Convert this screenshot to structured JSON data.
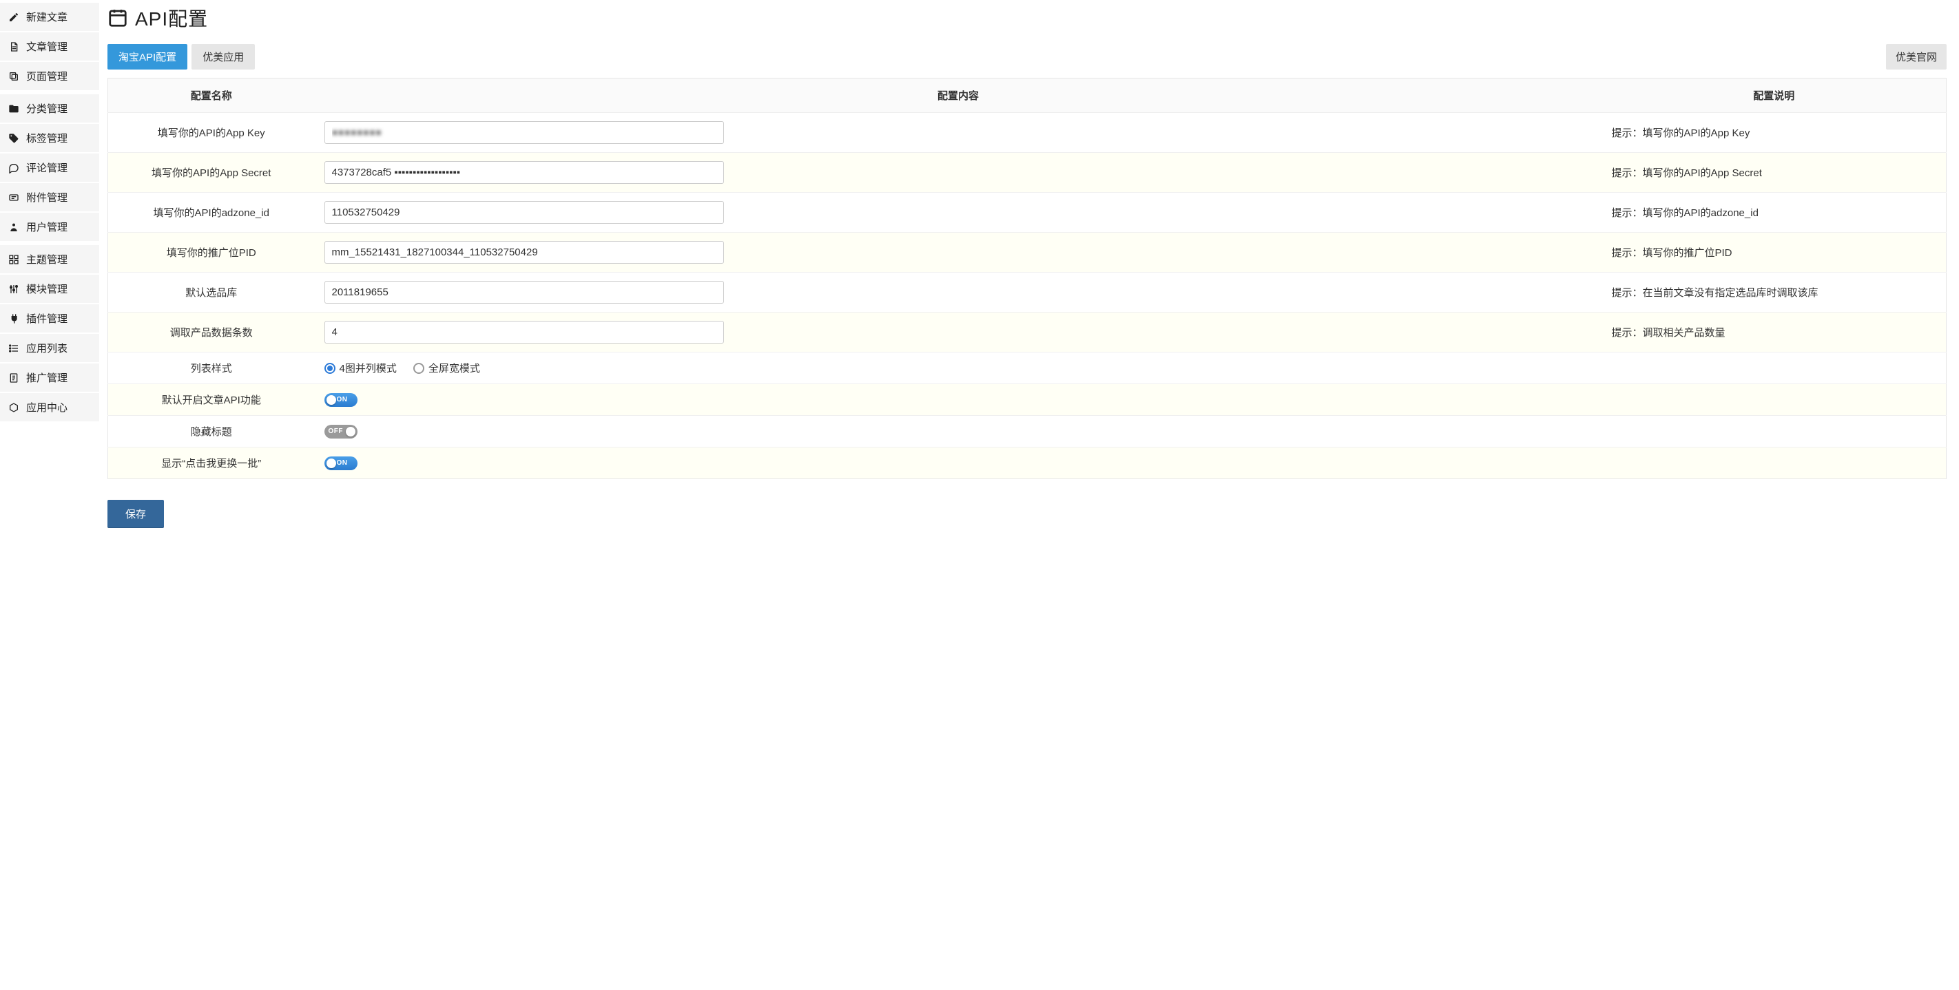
{
  "sidebar": {
    "groups": [
      [
        {
          "icon": "pencil",
          "label": "新建文章"
        },
        {
          "icon": "doc",
          "label": "文章管理"
        },
        {
          "icon": "copy",
          "label": "页面管理"
        }
      ],
      [
        {
          "icon": "folder",
          "label": "分类管理"
        },
        {
          "icon": "tag",
          "label": "标签管理"
        },
        {
          "icon": "comment",
          "label": "评论管理"
        },
        {
          "icon": "attach",
          "label": "附件管理"
        },
        {
          "icon": "user",
          "label": "用户管理"
        }
      ],
      [
        {
          "icon": "grid",
          "label": "主题管理"
        },
        {
          "icon": "module",
          "label": "模块管理"
        },
        {
          "icon": "plug",
          "label": "插件管理"
        },
        {
          "icon": "list",
          "label": "应用列表"
        },
        {
          "icon": "promo",
          "label": "推广管理"
        },
        {
          "icon": "cube",
          "label": "应用中心"
        }
      ]
    ]
  },
  "header": {
    "title": "API配置"
  },
  "tabs": {
    "items": [
      "淘宝API配置",
      "优美应用"
    ],
    "active_index": 0,
    "right_link": "优美官网"
  },
  "table": {
    "columns": [
      "配置名称",
      "配置内容",
      "配置说明"
    ]
  },
  "rows": [
    {
      "name": "填写你的API的App Key",
      "type": "text_blur",
      "value": "●●●●●●●●",
      "desc": "提示：填写你的API的App Key"
    },
    {
      "name": "填写你的API的App Secret",
      "type": "text_blur_partial",
      "value_prefix": "4373728caf5",
      "desc": "提示：填写你的API的App Secret"
    },
    {
      "name": "填写你的API的adzone_id",
      "type": "text",
      "value": "110532750429",
      "desc": "提示：填写你的API的adzone_id"
    },
    {
      "name": "填写你的推广位PID",
      "type": "text",
      "value": "mm_15521431_1827100344_110532750429",
      "desc": "提示：填写你的推广位PID"
    },
    {
      "name": "默认选品库",
      "type": "text",
      "value": "2011819655",
      "desc": "提示：在当前文章没有指定选品库时调取该库"
    },
    {
      "name": "调取产品数据条数",
      "type": "text",
      "value": "4",
      "desc": "提示：调取相关产品数量"
    },
    {
      "name": "列表样式",
      "type": "radio",
      "options": [
        "4图并列模式",
        "全屏宽模式"
      ],
      "selected": 0,
      "desc": ""
    },
    {
      "name": "默认开启文章API功能",
      "type": "toggle",
      "on": true,
      "desc": ""
    },
    {
      "name": "隐藏标题",
      "type": "toggle",
      "on": false,
      "desc": ""
    },
    {
      "name": "显示“点击我更换一批”",
      "type": "toggle",
      "on": true,
      "desc": ""
    }
  ],
  "toggle_labels": {
    "on": "ON",
    "off": "OFF"
  },
  "buttons": {
    "save": "保存"
  }
}
